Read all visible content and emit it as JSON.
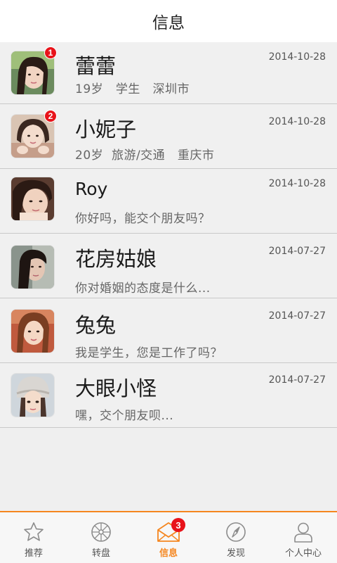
{
  "header": {
    "title": "信息"
  },
  "messages": [
    {
      "name": "蕾蕾",
      "sub": "19岁   学生   深圳市",
      "date": "2014-10-28",
      "badge": "1",
      "avatar_icon": "avatar-photo"
    },
    {
      "name": "小妮子",
      "sub": "20岁  旅游/交通   重庆市",
      "date": "2014-10-28",
      "badge": "2",
      "avatar_icon": "avatar-photo"
    },
    {
      "name": "Roy",
      "sub": "你好吗，能交个朋友吗？",
      "date": "2014-10-28",
      "avatar_icon": "avatar-photo"
    },
    {
      "name": "花房姑娘",
      "sub": "你对婚姻的态度是什么...",
      "date": "2014-07-27",
      "avatar_icon": "avatar-photo"
    },
    {
      "name": "兔兔",
      "sub": "我是学生，您是工作了吗？",
      "date": "2014-07-27",
      "avatar_icon": "avatar-photo"
    },
    {
      "name": "大眼小怪",
      "sub": "嘿，交个朋友呗...",
      "date": "2014-07-27",
      "avatar_icon": "avatar-photo"
    }
  ],
  "tabbar": {
    "active_color": "#f5861f",
    "tabs": [
      {
        "label": "推荐",
        "icon": "star-icon"
      },
      {
        "label": "转盘",
        "icon": "wheel-icon"
      },
      {
        "label": "信息",
        "icon": "mail-icon",
        "badge": "3",
        "active": true
      },
      {
        "label": "发现",
        "icon": "compass-icon"
      },
      {
        "label": "个人中心",
        "icon": "person-icon"
      }
    ]
  }
}
